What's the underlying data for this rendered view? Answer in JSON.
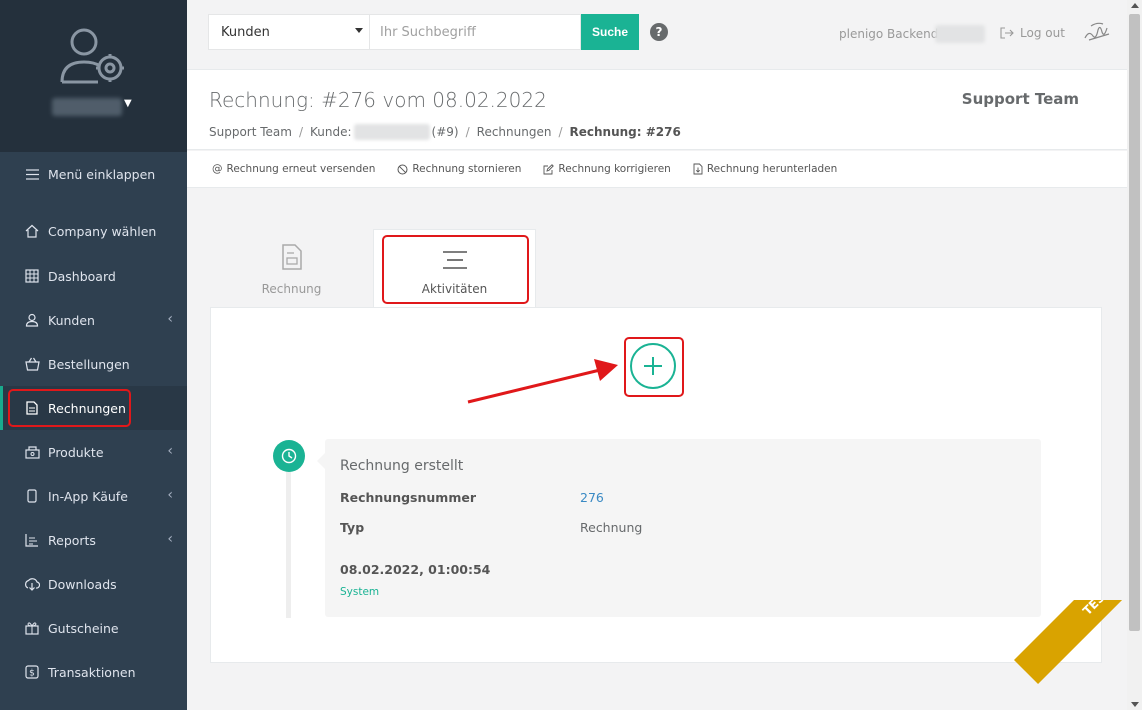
{
  "sidebar": {
    "items": [
      {
        "label": "Menü einklappen",
        "icon": "menu-icon"
      },
      {
        "label": "Company wählen",
        "icon": "home-icon"
      },
      {
        "label": "Dashboard",
        "icon": "grid-icon"
      },
      {
        "label": "Kunden",
        "icon": "user-icon"
      },
      {
        "label": "Bestellungen",
        "icon": "basket-icon"
      },
      {
        "label": "Rechnungen",
        "icon": "invoice-icon"
      },
      {
        "label": "Produkte",
        "icon": "box-icon"
      },
      {
        "label": "In-App Käufe",
        "icon": "phone-icon"
      },
      {
        "label": "Reports",
        "icon": "chart-icon"
      },
      {
        "label": "Downloads",
        "icon": "download-icon"
      },
      {
        "label": "Gutscheine",
        "icon": "gift-icon"
      },
      {
        "label": "Transaktionen",
        "icon": "money-icon"
      }
    ],
    "active": "Rechnungen"
  },
  "topbar": {
    "select_value": "Kunden",
    "search_placeholder": "Ihr Suchbegriff",
    "search_button": "Suche",
    "help": "?",
    "backend_label": "plenigo Backend",
    "logout": "Log out"
  },
  "heading": {
    "title": "Rechnung: #276 vom 08.02.2022",
    "team": "Support Team",
    "breadcrumb": {
      "team": "Support Team",
      "kunde_prefix": "Kunde:",
      "kunde_suffix": "(#9)",
      "rechnungen": "Rechnungen",
      "current": "Rechnung: #276"
    }
  },
  "actions": [
    {
      "label": "Rechnung erneut versenden",
      "icon": "at-icon"
    },
    {
      "label": "Rechnung stornieren",
      "icon": "ban-icon"
    },
    {
      "label": "Rechnung korrigieren",
      "icon": "edit-icon"
    },
    {
      "label": "Rechnung herunterladen",
      "icon": "file-download-icon"
    }
  ],
  "tabs": [
    {
      "label": "Rechnung",
      "icon": "document-icon"
    },
    {
      "label": "Aktivitäten",
      "icon": "list-icon"
    }
  ],
  "timeline": {
    "title": "Rechnung erstellt",
    "rows": [
      {
        "key": "Rechnungsnummer",
        "value": "276"
      },
      {
        "key": "Typ",
        "value": "Rechnung"
      }
    ],
    "date": "08.02.2022, 01:00:54",
    "author": "System"
  },
  "ribbon": "TEST",
  "colors": {
    "accent": "#1ab394",
    "sidebar": "#2f4050",
    "highlight": "#e0181a",
    "ribbon": "#d9a300"
  }
}
